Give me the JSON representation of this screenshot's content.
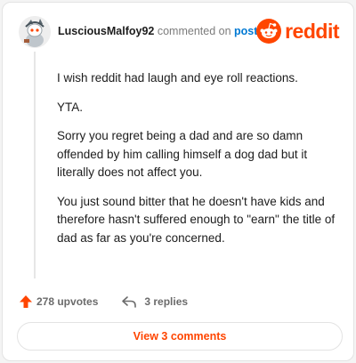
{
  "header": {
    "username": "LusciousMalfoy92",
    "verb": "commented on",
    "post_link": "post",
    "logo_text": "reddit"
  },
  "comment": {
    "paragraphs": [
      "I wish reddit had laugh and eye roll reactions.",
      "YTA.",
      "Sorry you regret being a dad and are so damn offended by him calling himself a dog dad but it literally does not affect you.",
      "You just sound bitter that he doesn't have kids and therefore hasn't suffered enough to \"earn\" the title of dad as far as you're concerned."
    ]
  },
  "actions": {
    "upvotes": "278 upvotes",
    "replies": "3 replies"
  },
  "view_button": "View 3 comments",
  "colors": {
    "brand": "#ff4500",
    "link": "#0079d3",
    "muted": "#7c7c7c"
  },
  "icons": [
    "avatar",
    "reddit-logo-icon",
    "upvote-arrow-icon",
    "reply-icon"
  ]
}
